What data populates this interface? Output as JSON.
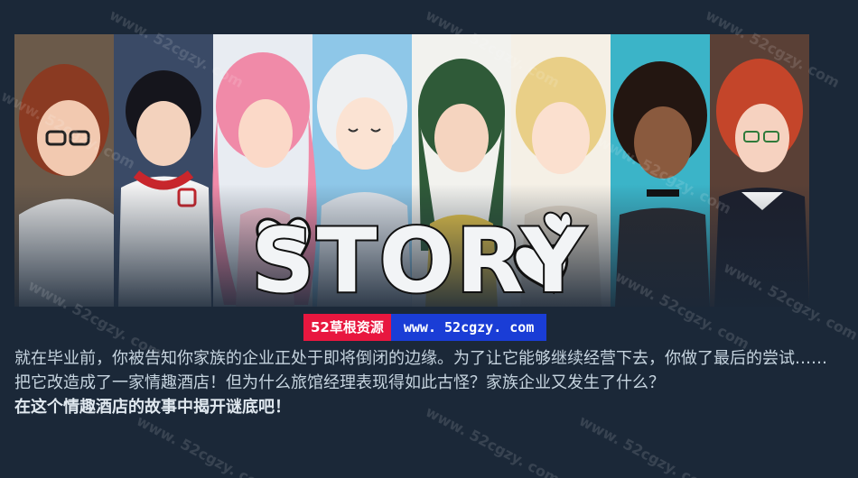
{
  "banner": {
    "logo_text": "STORY"
  },
  "watermark": {
    "left_label": "52草根资源",
    "right_label": "www. 52cgzy. com",
    "overlay_text": "www. 52cgzy. com"
  },
  "description": {
    "paragraph": "就在毕业前，你被告知你家族的企业正处于即将倒闭的边缘。为了让它能够继续经营下去，你做了最后的尝试……把它改造成了一家情趣酒店！但为什么旅馆经理表现得如此古怪？家族企业又发生了什么？",
    "bold_line": "在这个情趣酒店的故事中揭开谜底吧！"
  },
  "colors": {
    "background": "#1b2838",
    "text": "#c6d4df",
    "watermark_red": "#e8173f",
    "watermark_blue": "#1a3dd6"
  }
}
